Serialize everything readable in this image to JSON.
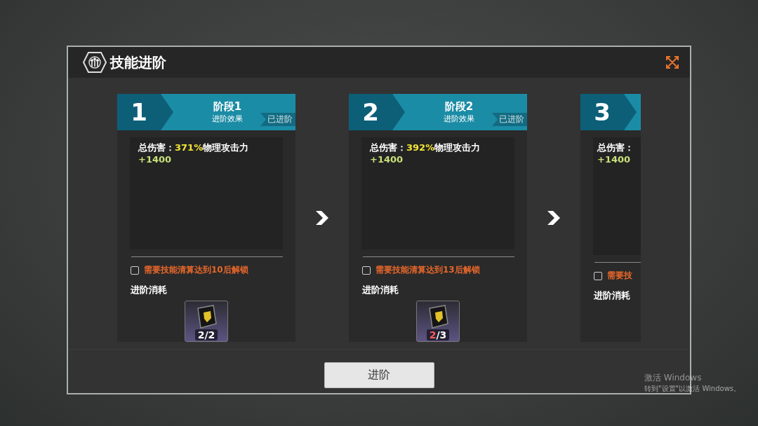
{
  "dialog": {
    "title": "技能进阶"
  },
  "stages": [
    {
      "number": "1",
      "title": "阶段1",
      "subtitle": "进阶效果",
      "badge": "已进阶",
      "effect_label": "总伤害：",
      "effect_value": "371%",
      "effect_suffix": "物理攻击力",
      "bonus": "+1400",
      "requirement": {
        "text": "需要技能清算达到10后解锁",
        "checked": false
      },
      "cost_label": "进阶消耗",
      "cost": {
        "owned": "2",
        "separator": "/",
        "required": "2",
        "enough": true
      }
    },
    {
      "number": "2",
      "title": "阶段2",
      "subtitle": "进阶效果",
      "badge": "已进阶",
      "effect_label": "总伤害：",
      "effect_value": "392%",
      "effect_suffix": "物理攻击力",
      "bonus": "+1400",
      "requirement": {
        "text": "需要技能清算达到13后解锁",
        "checked": false
      },
      "cost_label": "进阶消耗",
      "cost": {
        "owned": "2",
        "separator": "/",
        "required": "3",
        "enough": false
      }
    },
    {
      "number": "3",
      "clipped": true,
      "effect_label": "总伤害：",
      "bonus": "+1400",
      "requirement": {
        "text": "需要技",
        "checked": false
      },
      "cost_label": "进阶消耗"
    }
  ],
  "advance_button": "进阶",
  "os_notice": {
    "title": "激活 Windows",
    "text": "转到\"设置\"以激活 Windows。"
  }
}
